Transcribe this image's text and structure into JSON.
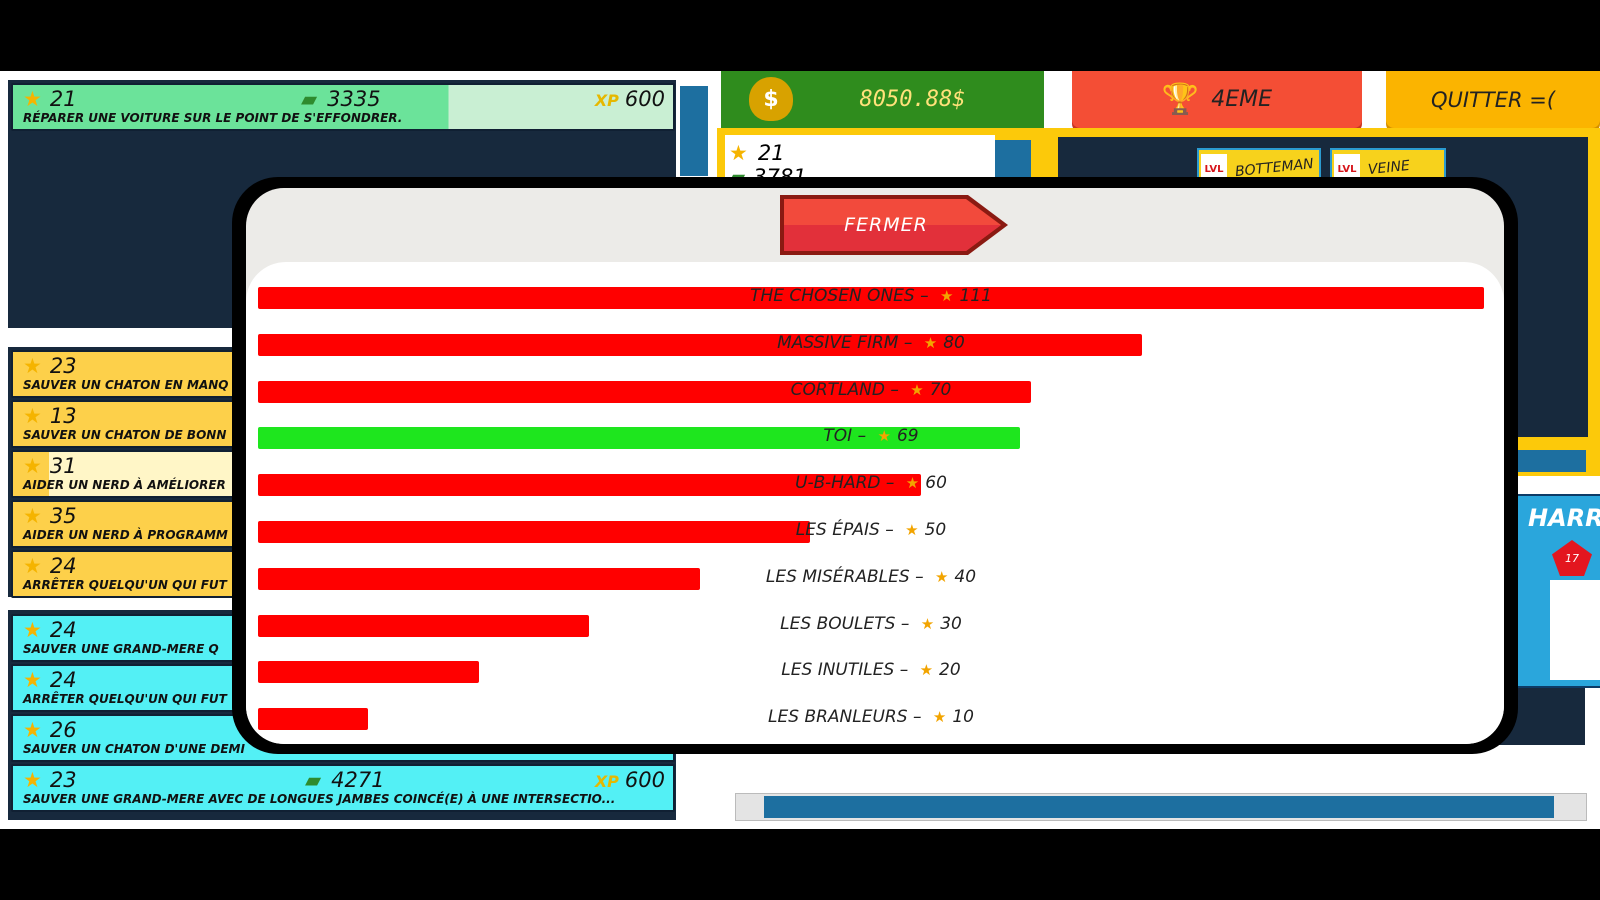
{
  "topbar": {
    "money": "8050.88$",
    "money_icon": "money-bag-icon",
    "rank": "4EME",
    "quit": "QUITTER =("
  },
  "missions_top": [
    {
      "stars": "21",
      "money": "3335",
      "xp": "600",
      "xp_label": "XP",
      "desc": "réparer une voiture sur le point de s'effondrer."
    }
  ],
  "missions_yellow": [
    {
      "stars": "23",
      "desc": "sauver un chaton en manq"
    },
    {
      "stars": "13",
      "desc": "sauver un chaton de bonn"
    },
    {
      "stars": "31",
      "desc": "aider un nerd à améliorer"
    },
    {
      "stars": "35",
      "desc": "aider un nerd à programm"
    },
    {
      "stars": "24",
      "desc": "arrêter quelqu'un qui fut"
    }
  ],
  "missions_cyan": [
    {
      "stars": "24",
      "desc": "sauver une grand-mere q"
    },
    {
      "stars": "24",
      "desc": "arrêter quelqu'un qui fut"
    },
    {
      "stars": "26",
      "desc": "sauver un chaton d'une demi"
    },
    {
      "stars": "23",
      "money": "4271",
      "xp": "600",
      "xp_label": "XP",
      "desc": "sauver une grand-mere avec de longues jambes coincé(e) à une intersectio..."
    }
  ],
  "right_card": {
    "stars": "21",
    "money": "3781"
  },
  "heroes": [
    {
      "lvl": "LVL",
      "name": "BOTTEMAN"
    },
    {
      "lvl": "LVL",
      "name": "VEINE"
    }
  ],
  "hero_card": {
    "name": "HARR",
    "level": "17"
  },
  "modal": {
    "close_label": "FERMER",
    "max_score": 111,
    "colors": {
      "team": "#ff0000",
      "player": "#1ee61e",
      "close_button": "#f24a3c"
    },
    "ranking": [
      {
        "team": "THE CHOSEN ONES",
        "score": 111,
        "is_player": false
      },
      {
        "team": "MASSIVE FIRM",
        "score": 80,
        "is_player": false
      },
      {
        "team": "CORTLAND",
        "score": 70,
        "is_player": false
      },
      {
        "team": "TOI",
        "score": 69,
        "is_player": true
      },
      {
        "team": "U-B-HARD",
        "score": 60,
        "is_player": false
      },
      {
        "team": "LES ÉPAIS",
        "score": 50,
        "is_player": false
      },
      {
        "team": "LES MISéRABLES",
        "score": 40,
        "is_player": false
      },
      {
        "team": "LES BOULETS",
        "score": 30,
        "is_player": false
      },
      {
        "team": "LES INUTILES",
        "score": 20,
        "is_player": false
      },
      {
        "team": "LES BRANLEURS",
        "score": 10,
        "is_player": false
      }
    ],
    "separator": "–",
    "star_icon": "star-icon"
  }
}
